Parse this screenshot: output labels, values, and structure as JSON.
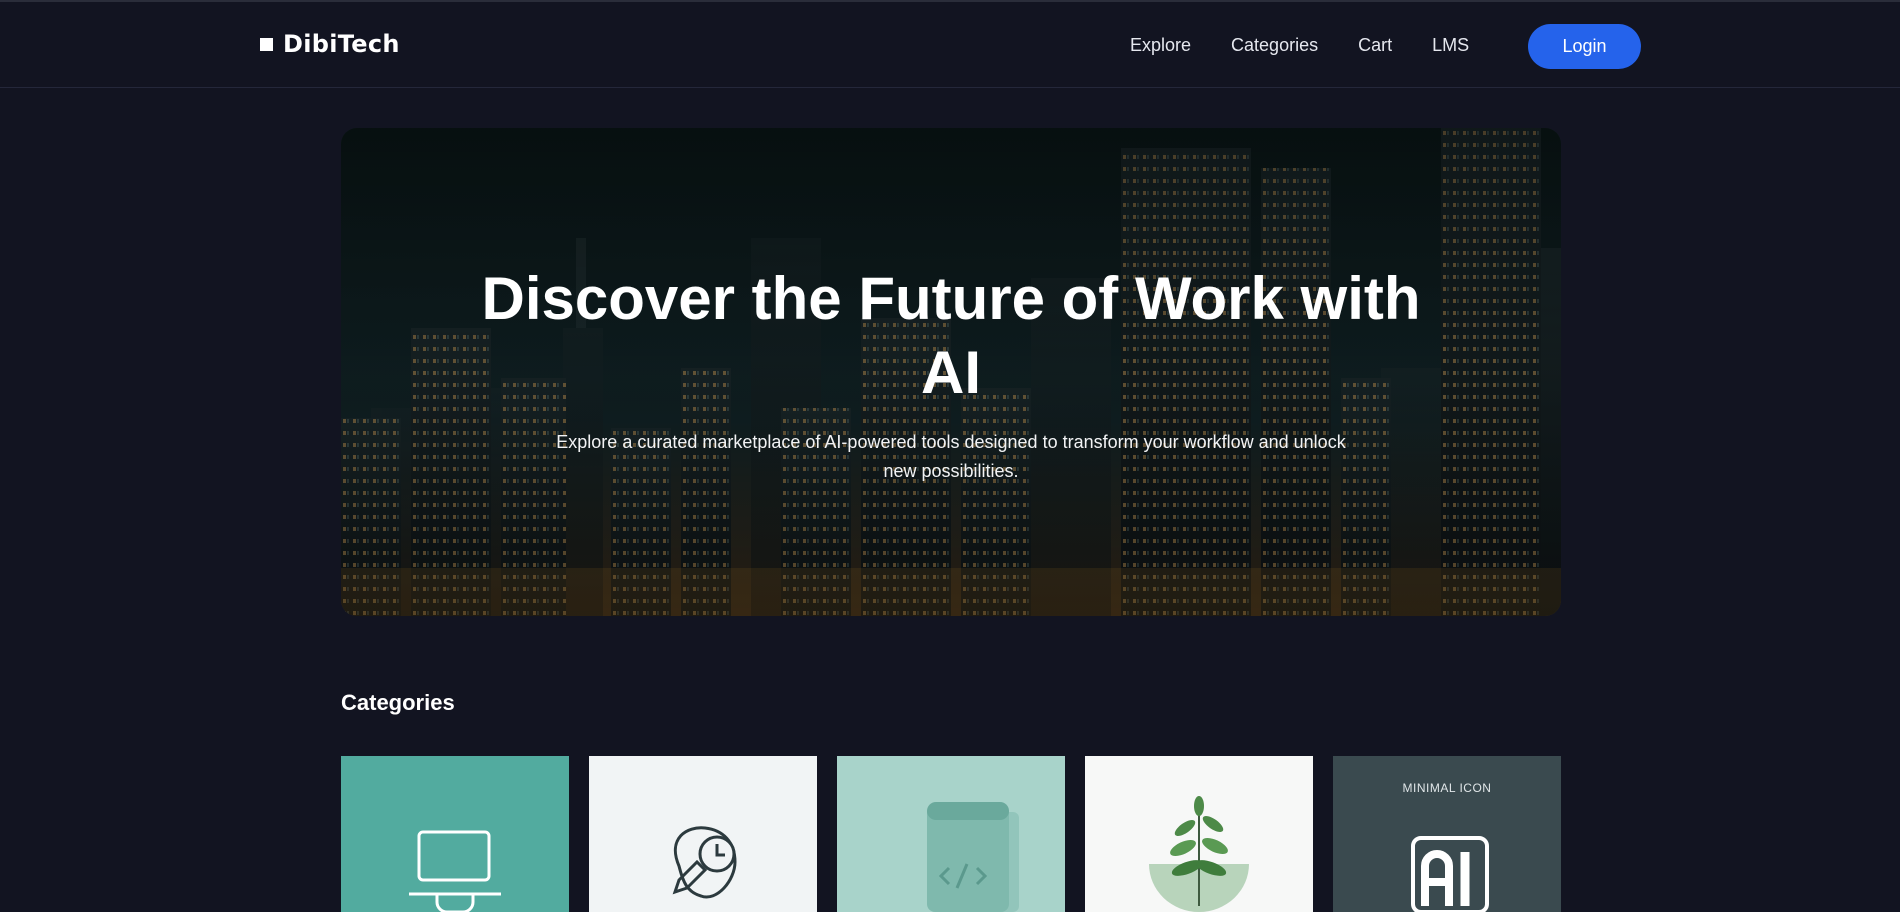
{
  "brand": {
    "name": "DibiTech",
    "logo_icon": "square-logo-icon"
  },
  "nav": {
    "items": [
      {
        "label": "Explore"
      },
      {
        "label": "Categories"
      },
      {
        "label": "Cart"
      },
      {
        "label": "LMS"
      }
    ],
    "login_label": "Login"
  },
  "hero": {
    "title": "Discover the Future of Work with AI",
    "subtitle": "Explore a curated marketplace of AI-powered tools designed to transform your workflow and unlock new possibilities.",
    "background_image": "night-city-skyline"
  },
  "categories": {
    "heading": "Categories",
    "cards": [
      {
        "icon": "laptop-icon",
        "background": "#52ab9f"
      },
      {
        "icon": "pencil-clock-icon",
        "background": "#f1f4f5"
      },
      {
        "icon": "code-scroll-icon",
        "background": "#a8d3ca"
      },
      {
        "icon": "plant-bowl-icon",
        "background": "#f7f8f7"
      },
      {
        "icon": "ai-chip-icon",
        "background": "#3a4a4f",
        "caption": "MINIMAL ICON"
      }
    ]
  },
  "colors": {
    "page_background": "#121421",
    "accent": "#2563eb",
    "text": "#ffffff"
  }
}
